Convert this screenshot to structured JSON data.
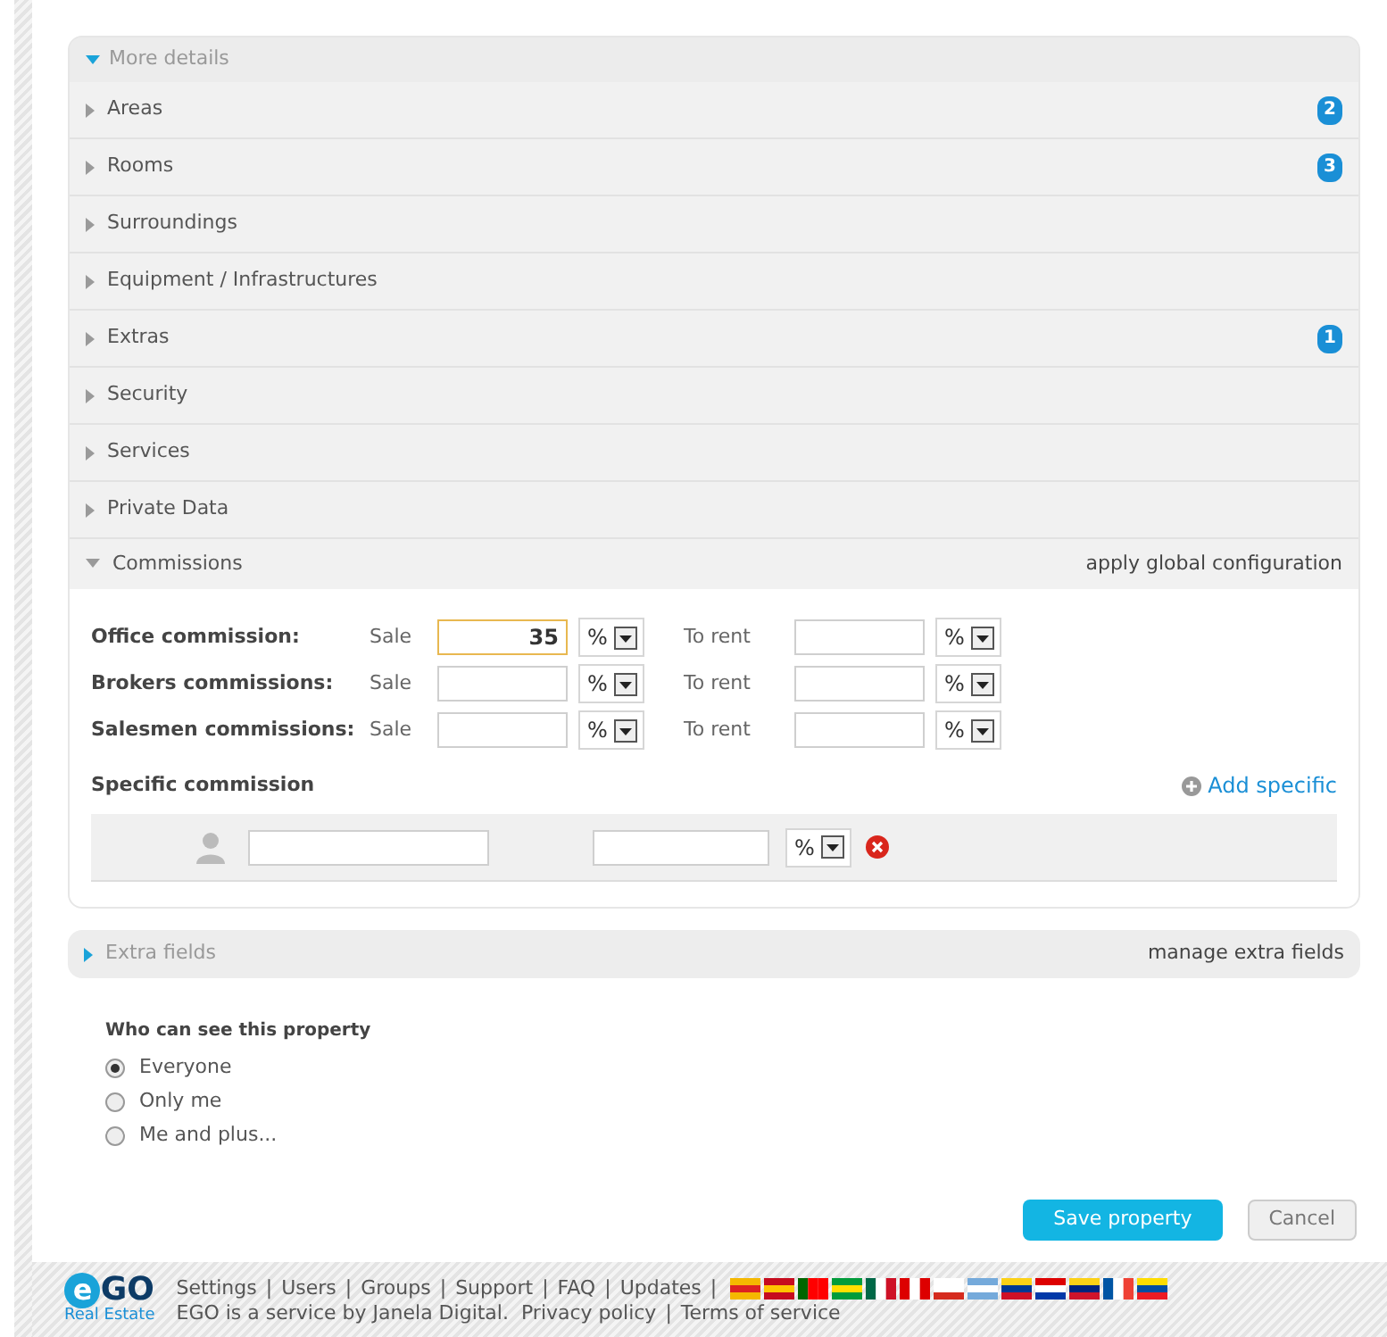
{
  "more_details": {
    "title": "More details",
    "expanded": true
  },
  "sections": [
    {
      "label": "Areas",
      "count": "2",
      "expanded": false
    },
    {
      "label": "Rooms",
      "count": "3",
      "expanded": false
    },
    {
      "label": "Surroundings",
      "expanded": false
    },
    {
      "label": "Equipment / Infrastructures",
      "expanded": false
    },
    {
      "label": "Extras",
      "count": "1",
      "expanded": false
    },
    {
      "label": "Security",
      "expanded": false
    },
    {
      "label": "Services",
      "expanded": false
    },
    {
      "label": "Private Data",
      "expanded": false
    }
  ],
  "commissions": {
    "title": "Commissions",
    "expanded": true,
    "action": "apply global configuration",
    "rows": [
      {
        "label": "Office commission:",
        "sale_label": "Sale",
        "sale_value": "35",
        "sale_focused": true,
        "sale_unit": "%",
        "rent_label": "To rent",
        "rent_focused": false,
        "rent_unit": "%"
      },
      {
        "label": "Brokers commissions:",
        "sale_label": "Sale",
        "sale_focused": false,
        "sale_unit": "%",
        "rent_label": "To rent",
        "rent_focused": false,
        "rent_unit": "%"
      },
      {
        "label": "Salesmen commissions:",
        "sale_label": "Sale",
        "sale_focused": false,
        "sale_unit": "%",
        "rent_label": "To rent",
        "rent_focused": false,
        "rent_unit": "%"
      }
    ],
    "specific": {
      "title": "Specific commission",
      "add": "Add specific",
      "unit": "%"
    }
  },
  "extra_fields": {
    "title": "Extra fields",
    "expanded": false,
    "action": "manage extra fields"
  },
  "visibility": {
    "title": "Who can see this property",
    "options": [
      {
        "label": "Everyone",
        "selected": true
      },
      {
        "label": "Only me",
        "selected": false
      },
      {
        "label": "Me and plus...",
        "selected": false
      }
    ]
  },
  "buttons": {
    "save": "Save property",
    "cancel": "Cancel"
  },
  "footer": {
    "logo_mark": "e",
    "logo_name": "GO",
    "logo_sub": "Real Estate",
    "separator": "|",
    "links": [
      "Settings",
      "Users",
      "Groups",
      "Support",
      "FAQ",
      "Updates"
    ],
    "service_text": "EGO is a service by Janela Digital.",
    "legal_links": [
      "Privacy policy",
      "Terms of service"
    ]
  }
}
